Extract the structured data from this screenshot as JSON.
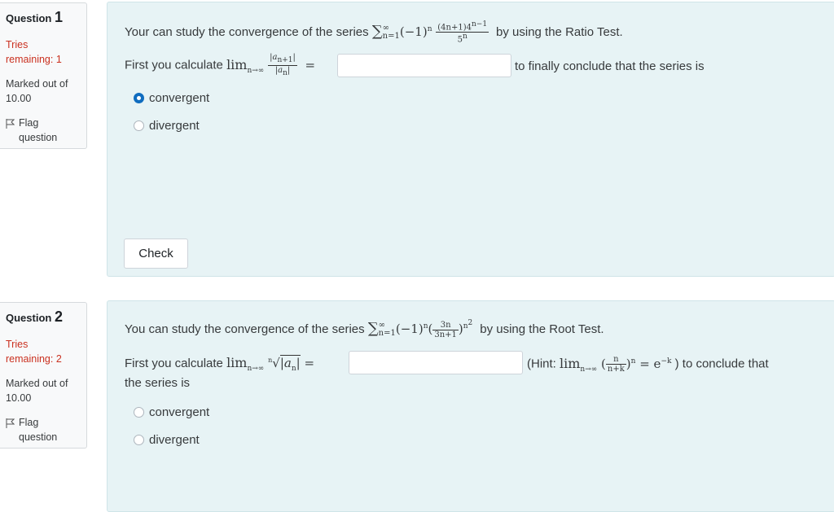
{
  "q1": {
    "label": "Question",
    "number": "1",
    "tries_label": "Tries",
    "tries_remaining": "remaining: 1",
    "marked_label": "Marked out of",
    "marked_value": "10.00",
    "flag_label": "Flag",
    "flag_label2": "question",
    "text_prefix": "Your can study the convergence of the series",
    "math_sigma": "∑",
    "math_sup": "∞",
    "math_sub": "n=1",
    "math_term": "(−1)",
    "math_exp_n": "n",
    "frac_num": "(4n+1)4",
    "frac_num_exp": "n−1",
    "frac_den": "5",
    "frac_den_exp": "n",
    "text_suffix": "by using the Ratio Test.",
    "calc_prefix": "First you  calculate",
    "lim": "lim",
    "lim_sub": "n→∞",
    "ratio_num": "|a",
    "ratio_num_sub": "n+1",
    "ratio_num_end": "|",
    "ratio_den": "|a",
    "ratio_den_sub": "n",
    "ratio_den_end": "|",
    "equals": "=",
    "calc_suffix": "to  finally conclude that the series is",
    "options": [
      "convergent",
      "divergent"
    ],
    "selected_index": 0,
    "check_label": "Check"
  },
  "q2": {
    "label": "Question",
    "number": "2",
    "tries_label": "Tries",
    "tries_remaining": "remaining: 2",
    "marked_label": "Marked out of",
    "marked_value": "10.00",
    "flag_label": "Flag",
    "flag_label2": "question",
    "text_prefix": "You can study the convergence of the series",
    "math_sigma": "∑",
    "math_sup": "∞",
    "math_sub": "n=1",
    "math_term": "(−1)",
    "math_exp_n": "n",
    "frac_num": "3n",
    "frac_den": "3n+1",
    "paren_exp": "n",
    "paren_exp2": "2",
    "text_suffix": "by using the Root Test.",
    "calc_prefix": "First you calculate",
    "lim": "lim",
    "lim_sub": "n→∞",
    "root_index": "n",
    "root_body": "|a",
    "root_sub": "n",
    "root_end": "|",
    "equals": "=",
    "hint_prefix": "(Hint:",
    "hint_frac_num": "n",
    "hint_frac_den": "n+k",
    "hint_exp": "n",
    "hint_eq": "= e",
    "hint_eq_exp": "−k",
    "hint_suffix": ") to conclude that",
    "line3": "the series is",
    "options": [
      "convergent",
      "divergent"
    ],
    "selected_index": -1
  }
}
